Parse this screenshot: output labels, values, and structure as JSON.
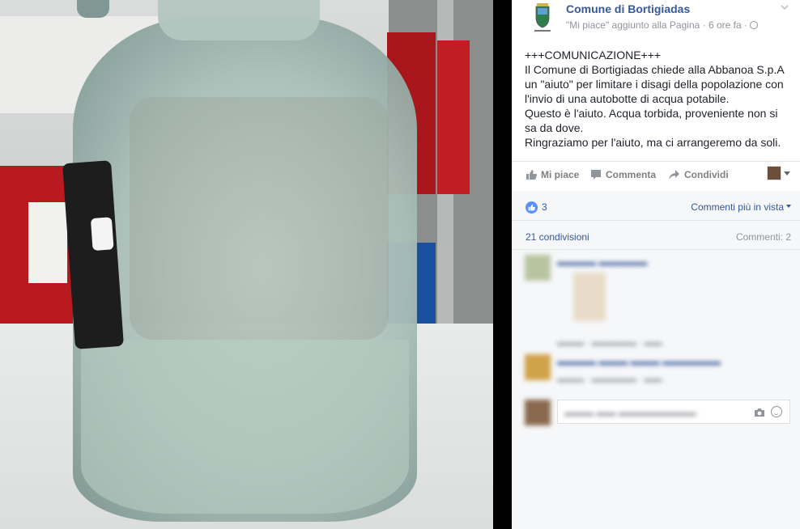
{
  "post": {
    "page_name": "Comune di Bortigiadas",
    "subline": "\"Mi piace\" aggiunto alla Pagina · 6 ore fa ·",
    "text_lines": [
      "+++COMUNICAZIONE+++",
      "Il Comune di Bortigiadas chiede alla Abbanoa S.p.A",
      "un \"aiuto\" per limitare i disagi della popolazione con",
      "l'invio di una autobotte di acqua potabile.",
      "Questo è l'aiuto. Acqua torbida, proveniente non si",
      "sa da dove.",
      "Ringraziamo per l'aiuto, ma ci arrangeremo da soli."
    ]
  },
  "actions": {
    "like": "Mi piace",
    "comment": "Commenta",
    "share": "Condividi"
  },
  "feedback": {
    "like_count": "3",
    "sort_label": "Commenti più in vista",
    "shares": "21 condivisioni",
    "comments": "Commenti: 2"
  },
  "icons": {
    "like": "thumbs-up-icon",
    "comment": "speech-bubble-icon",
    "share": "share-arrow-icon",
    "camera": "camera-icon",
    "emoji": "smiley-icon",
    "globe": "globe-icon",
    "chevron": "chevron-down-icon"
  },
  "colors": {
    "link": "#365899",
    "muted": "#90949c",
    "like_blue": "#5890ff",
    "panel_bg": "#f6f7f9"
  }
}
